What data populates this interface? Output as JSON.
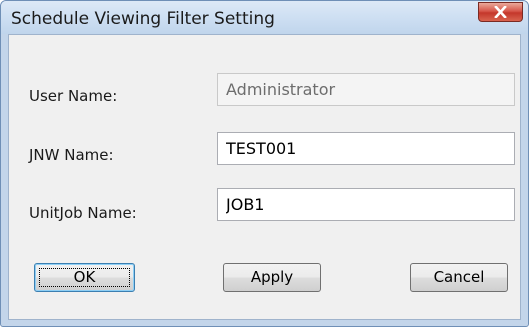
{
  "window": {
    "title": "Schedule Viewing Filter Setting",
    "close_icon": "close-icon"
  },
  "form": {
    "user_name": {
      "label": "User Name:",
      "value": "Administrator",
      "disabled": true
    },
    "jnw_name": {
      "label": "JNW Name:",
      "value": "TEST001"
    },
    "unitjob_name": {
      "label": "UnitJob Name:",
      "value": "JOB1"
    }
  },
  "buttons": {
    "ok": "OK",
    "apply": "Apply",
    "cancel": "Cancel"
  },
  "colors": {
    "frame": "#c3d5ea",
    "close_button": "#c4372b",
    "client_bg": "#f0f0f0"
  }
}
